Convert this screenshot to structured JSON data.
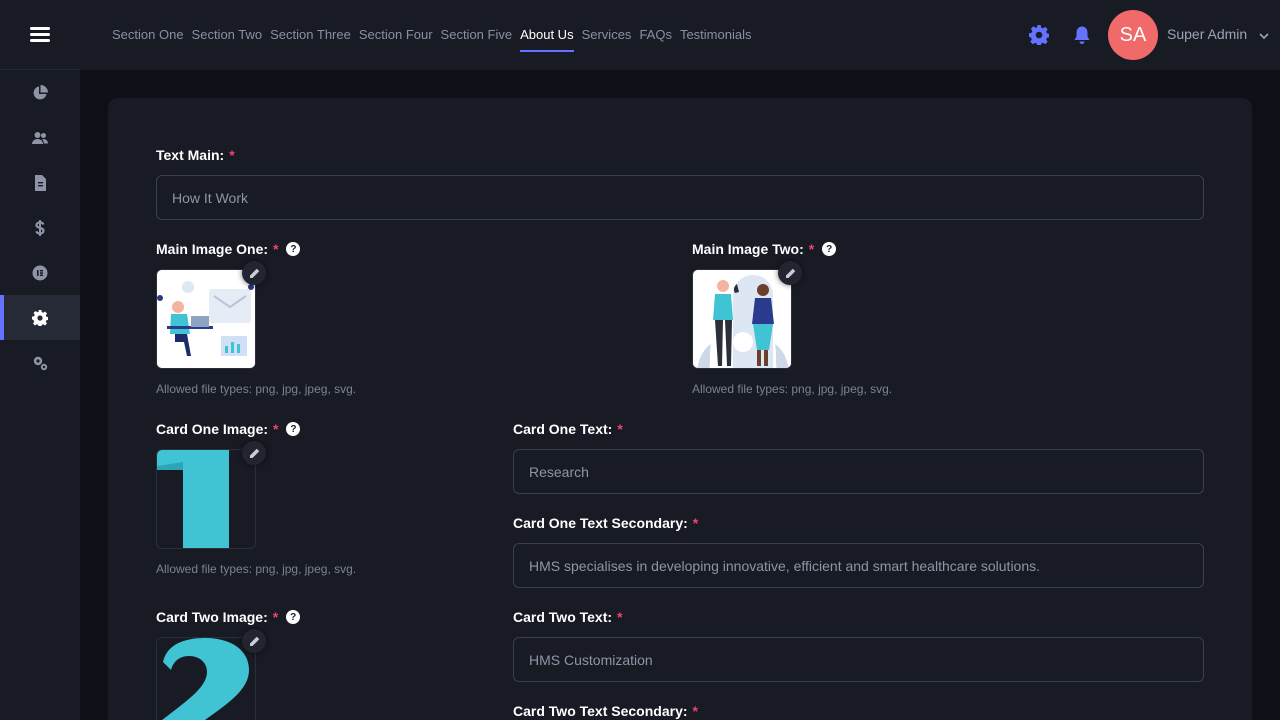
{
  "nav": {
    "items": [
      "Section One",
      "Section Two",
      "Section Three",
      "Section Four",
      "Section Five",
      "About Us",
      "Services",
      "FAQs",
      "Testimonials"
    ],
    "active": "About Us"
  },
  "user": {
    "initials": "SA",
    "name": "Super Admin"
  },
  "sidebar": {
    "icons": [
      "dashboard-pie-icon",
      "users-icon",
      "document-icon",
      "dollar-icon",
      "circle-menu-icon",
      "settings-gear-icon",
      "multi-gear-icon"
    ],
    "active_index": 5
  },
  "form": {
    "text_main": {
      "label": "Text Main:",
      "value": "How It Work"
    },
    "main_image_one": {
      "label": "Main Image One:",
      "hint": "Allowed file types: png, jpg, jpeg, svg."
    },
    "main_image_two": {
      "label": "Main Image Two:",
      "hint": "Allowed file types: png, jpg, jpeg, svg."
    },
    "card_one_image": {
      "label": "Card One Image:",
      "hint": "Allowed file types: png, jpg, jpeg, svg."
    },
    "card_one_text": {
      "label": "Card One Text:",
      "value": "Research"
    },
    "card_one_text_secondary": {
      "label": "Card One Text Secondary:",
      "value": "HMS specialises in developing innovative, efficient and smart healthcare solutions."
    },
    "card_two_image": {
      "label": "Card Two Image:"
    },
    "card_two_text": {
      "label": "Card Two Text:",
      "value": "HMS Customization"
    },
    "card_two_text_secondary": {
      "label": "Card Two Text Secondary:"
    },
    "required_mark": "*",
    "help_mark": "?"
  },
  "images": {
    "card_one_digit": "1",
    "card_two_digit": "2",
    "accent": "#40c4d4"
  },
  "colors": {
    "accent": "#6571ff",
    "required": "#f1416c",
    "avatar": "#f06a6a"
  }
}
